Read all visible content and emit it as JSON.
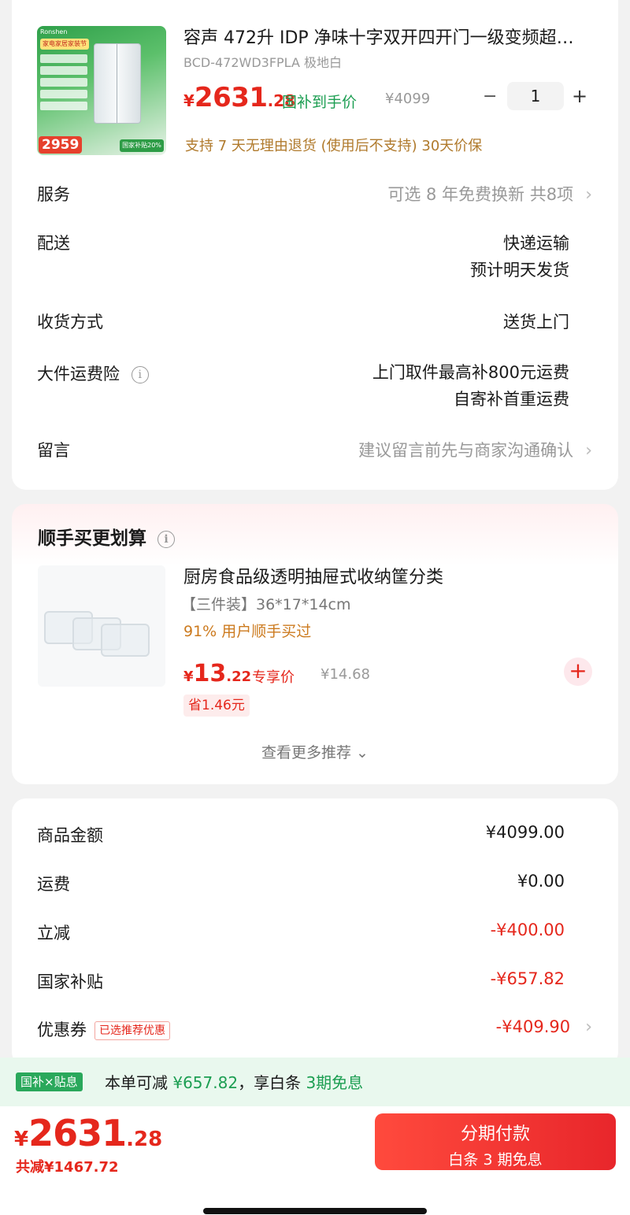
{
  "product": {
    "thumb_brand": "Ronshen",
    "thumb_tag": "家电家居家装节",
    "thumb_price": "2959",
    "thumb_badge": "国家补贴20%",
    "title": "容声 472升 IDP 净味十字双开四开门一级变频超…",
    "spec": "BCD-472WD3FPLA 极地白",
    "price_cur": "¥",
    "price_int": "2631",
    "price_dec": ".28",
    "subsidy_label": "国补到手价",
    "orig_price": "¥4099",
    "qty_minus": "−",
    "qty": "1",
    "qty_plus": "+",
    "policy": "支持 7 天无理由退货 (使用后不支持)   30天价保"
  },
  "rows": [
    {
      "label": "服务",
      "value": "可选 8 年免费换新 共8项",
      "chevron": "›"
    },
    {
      "label": "配送",
      "value1": "快递运输",
      "value2": "预计明天发货"
    },
    {
      "label": "收货方式",
      "value": "送货上门"
    },
    {
      "label": "大件运费险",
      "info": "i",
      "value1": "上门取件最高补800元运费",
      "value2": "自寄补首重运费"
    },
    {
      "label": "留言",
      "value": "建议留言前先与商家沟通确认",
      "chevron": "›"
    }
  ],
  "recommend": {
    "title": "顺手买更划算",
    "info": "i",
    "name": "厨房食品级透明抽屉式收纳筐分类",
    "spec": "【三件装】36*17*14cm",
    "percent": "91% 用户顺手买过",
    "price_cur": "¥",
    "price_int": "13",
    "price_dec": ".22",
    "exclusive": "专享价",
    "orig": "¥14.68",
    "save": "省1.46元",
    "add": "+",
    "more": "查看更多推荐 ⌄"
  },
  "summary": [
    {
      "label": "商品金额",
      "value": "¥4099.00"
    },
    {
      "label": "运费",
      "value": "¥0.00"
    },
    {
      "label": "立减",
      "value": "-¥400.00"
    },
    {
      "label": "国家补贴",
      "value": "-¥657.82"
    },
    {
      "label": "优惠券",
      "tag": "已选推荐优惠",
      "value": "-¥409.90",
      "chevron": "›"
    }
  ],
  "subsidy_bar": {
    "tag": "国补×贴息",
    "text_pre": "本单可减 ",
    "amount": "¥657.82",
    "text_mid": "，享白条 ",
    "periods": "3期免息"
  },
  "bottom": {
    "price_cur": "¥",
    "price_int": "2631",
    "price_dec": ".28",
    "total_save": "共减¥1467.72",
    "pay_line1": "分期付款",
    "pay_line2": "白条 3 期免息"
  },
  "colors": {
    "accent_red": "#e5271c",
    "subsidy_green": "#1c9e52",
    "policy_gold": "#b07a2c"
  }
}
